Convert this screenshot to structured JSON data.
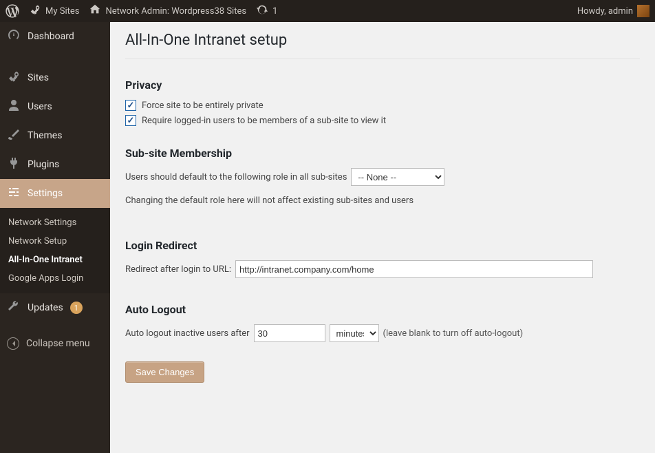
{
  "adminbar": {
    "my_sites": "My Sites",
    "network_admin": "Network Admin: Wordpress38 Sites",
    "refresh_count": "1",
    "howdy": "Howdy, admin"
  },
  "sidebar": {
    "dashboard": "Dashboard",
    "sites": "Sites",
    "users": "Users",
    "themes": "Themes",
    "plugins": "Plugins",
    "settings": "Settings",
    "settings_sub": {
      "network_settings": "Network Settings",
      "network_setup": "Network Setup",
      "aio_intranet": "All-In-One Intranet",
      "google_apps": "Google Apps Login"
    },
    "updates": "Updates",
    "updates_count": "1",
    "collapse": "Collapse menu"
  },
  "page": {
    "title": "All-In-One Intranet setup",
    "privacy": {
      "heading": "Privacy",
      "force_private": {
        "label": "Force site to be entirely private",
        "checked": true
      },
      "require_member": {
        "label": "Require logged-in users to be members of a sub-site to view it",
        "checked": true
      }
    },
    "membership": {
      "heading": "Sub-site Membership",
      "prompt": "Users should default to the following role in all sub-sites",
      "selected_role": "-- None --",
      "note": "Changing the default role here will not affect existing sub-sites and users"
    },
    "redirect": {
      "heading": "Login Redirect",
      "label": "Redirect after login to URL:",
      "value": "http://intranet.company.com/home"
    },
    "logout": {
      "heading": "Auto Logout",
      "label": "Auto logout inactive users after",
      "value": "30",
      "unit": "minutes",
      "hint": "(leave blank to turn off auto-logout)"
    },
    "save": "Save Changes"
  }
}
